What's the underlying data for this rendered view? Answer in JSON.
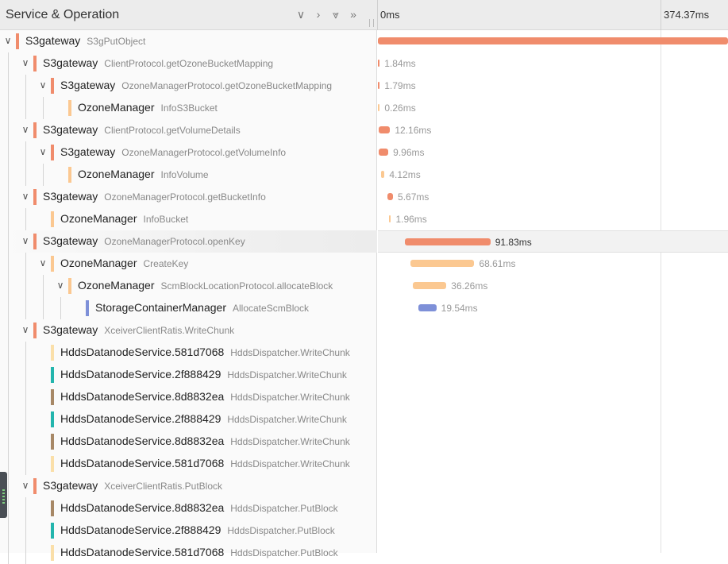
{
  "header": {
    "title": "Service & Operation",
    "controls": [
      {
        "name": "collapse-one",
        "glyph": "∨"
      },
      {
        "name": "expand-one",
        "glyph": "›"
      },
      {
        "name": "collapse-all",
        "glyph": "⩔"
      },
      {
        "name": "expand-all",
        "glyph": "»"
      }
    ],
    "ticks": [
      "0ms",
      "374.37ms"
    ]
  },
  "colors": {
    "s3gateway": "#f08c6c",
    "ozonemanager": "#fbc891",
    "storagecontainer": "#7e90d8",
    "hdds_581d7068": "#fadfa9",
    "hdds_2f888429": "#23b5ad",
    "hdds_8d8832ea": "#a78866"
  },
  "spans": [
    {
      "service": "S3gateway",
      "op": "S3gPutObject",
      "depth": 0,
      "toggle": true,
      "color": "s3gateway",
      "start": 0,
      "dur": 374.37,
      "label": ""
    },
    {
      "service": "S3gateway",
      "op": "ClientProtocol.getOzoneBucketMapping",
      "depth": 1,
      "toggle": true,
      "color": "s3gateway",
      "start": 0.2,
      "dur": 0.6,
      "label": "1.84ms"
    },
    {
      "service": "S3gateway",
      "op": "OzoneManagerProtocol.getOzoneBucketMapping",
      "depth": 2,
      "toggle": true,
      "color": "s3gateway",
      "start": 0.2,
      "dur": 0.6,
      "label": "1.79ms"
    },
    {
      "service": "OzoneManager",
      "op": "InfoS3Bucket",
      "depth": 3,
      "toggle": false,
      "color": "ozonemanager",
      "start": 0.3,
      "dur": 0.26,
      "label": "0.26ms"
    },
    {
      "service": "S3gateway",
      "op": "ClientProtocol.getVolumeDetails",
      "depth": 1,
      "toggle": true,
      "color": "s3gateway",
      "start": 0.9,
      "dur": 12.16,
      "label": "12.16ms"
    },
    {
      "service": "S3gateway",
      "op": "OzoneManagerProtocol.getVolumeInfo",
      "depth": 2,
      "toggle": true,
      "color": "s3gateway",
      "start": 1.2,
      "dur": 9.96,
      "label": "9.96ms"
    },
    {
      "service": "OzoneManager",
      "op": "InfoVolume",
      "depth": 3,
      "toggle": false,
      "color": "ozonemanager",
      "start": 3.0,
      "dur": 4.12,
      "label": "4.12ms"
    },
    {
      "service": "S3gateway",
      "op": "OzoneManagerProtocol.getBucketInfo",
      "depth": 1,
      "toggle": true,
      "color": "s3gateway",
      "start": 10.5,
      "dur": 5.67,
      "label": "5.67ms"
    },
    {
      "service": "OzoneManager",
      "op": "InfoBucket",
      "depth": 2,
      "toggle": false,
      "color": "ozonemanager",
      "start": 12.0,
      "dur": 1.96,
      "label": "1.96ms"
    },
    {
      "service": "S3gateway",
      "op": "OzoneManagerProtocol.openKey",
      "depth": 1,
      "toggle": true,
      "color": "s3gateway",
      "start": 28.5,
      "dur": 91.83,
      "label": "91.83ms",
      "highlight": true
    },
    {
      "service": "OzoneManager",
      "op": "CreateKey",
      "depth": 2,
      "toggle": true,
      "color": "ozonemanager",
      "start": 34.5,
      "dur": 68.61,
      "label": "68.61ms"
    },
    {
      "service": "OzoneManager",
      "op": "ScmBlockLocationProtocol.allocateBlock",
      "depth": 3,
      "toggle": true,
      "color": "ozonemanager",
      "start": 37.0,
      "dur": 36.26,
      "label": "36.26ms"
    },
    {
      "service": "StorageContainerManager",
      "op": "AllocateScmBlock",
      "depth": 4,
      "toggle": false,
      "color": "storagecontainer",
      "start": 43.0,
      "dur": 19.54,
      "label": "19.54ms"
    },
    {
      "service": "S3gateway",
      "op": "XceiverClientRatis.WriteChunk",
      "depth": 1,
      "toggle": true,
      "color": "s3gateway",
      "start": 0,
      "dur": 0,
      "label": ""
    },
    {
      "service": "HddsDatanodeService.581d7068",
      "op": "HddsDispatcher.WriteChunk",
      "depth": 2,
      "toggle": false,
      "color": "hdds_581d7068",
      "start": 0,
      "dur": 0,
      "label": ""
    },
    {
      "service": "HddsDatanodeService.2f888429",
      "op": "HddsDispatcher.WriteChunk",
      "depth": 2,
      "toggle": false,
      "color": "hdds_2f888429",
      "start": 0,
      "dur": 0,
      "label": ""
    },
    {
      "service": "HddsDatanodeService.8d8832ea",
      "op": "HddsDispatcher.WriteChunk",
      "depth": 2,
      "toggle": false,
      "color": "hdds_8d8832ea",
      "start": 0,
      "dur": 0,
      "label": ""
    },
    {
      "service": "HddsDatanodeService.2f888429",
      "op": "HddsDispatcher.WriteChunk",
      "depth": 2,
      "toggle": false,
      "color": "hdds_2f888429",
      "start": 0,
      "dur": 0,
      "label": ""
    },
    {
      "service": "HddsDatanodeService.8d8832ea",
      "op": "HddsDispatcher.WriteChunk",
      "depth": 2,
      "toggle": false,
      "color": "hdds_8d8832ea",
      "start": 0,
      "dur": 0,
      "label": ""
    },
    {
      "service": "HddsDatanodeService.581d7068",
      "op": "HddsDispatcher.WriteChunk",
      "depth": 2,
      "toggle": false,
      "color": "hdds_581d7068",
      "start": 0,
      "dur": 0,
      "label": ""
    },
    {
      "service": "S3gateway",
      "op": "XceiverClientRatis.PutBlock",
      "depth": 1,
      "toggle": true,
      "color": "s3gateway",
      "start": 0,
      "dur": 0,
      "label": ""
    },
    {
      "service": "HddsDatanodeService.8d8832ea",
      "op": "HddsDispatcher.PutBlock",
      "depth": 2,
      "toggle": false,
      "color": "hdds_8d8832ea",
      "start": 0,
      "dur": 0,
      "label": ""
    },
    {
      "service": "HddsDatanodeService.2f888429",
      "op": "HddsDispatcher.PutBlock",
      "depth": 2,
      "toggle": false,
      "color": "hdds_2f888429",
      "start": 0,
      "dur": 0,
      "label": ""
    },
    {
      "service": "HddsDatanodeService.581d7068",
      "op": "HddsDispatcher.PutBlock",
      "depth": 2,
      "toggle": false,
      "color": "hdds_581d7068",
      "start": 0,
      "dur": 0,
      "label": ""
    }
  ],
  "timeline": {
    "total_ms": 374.37
  }
}
